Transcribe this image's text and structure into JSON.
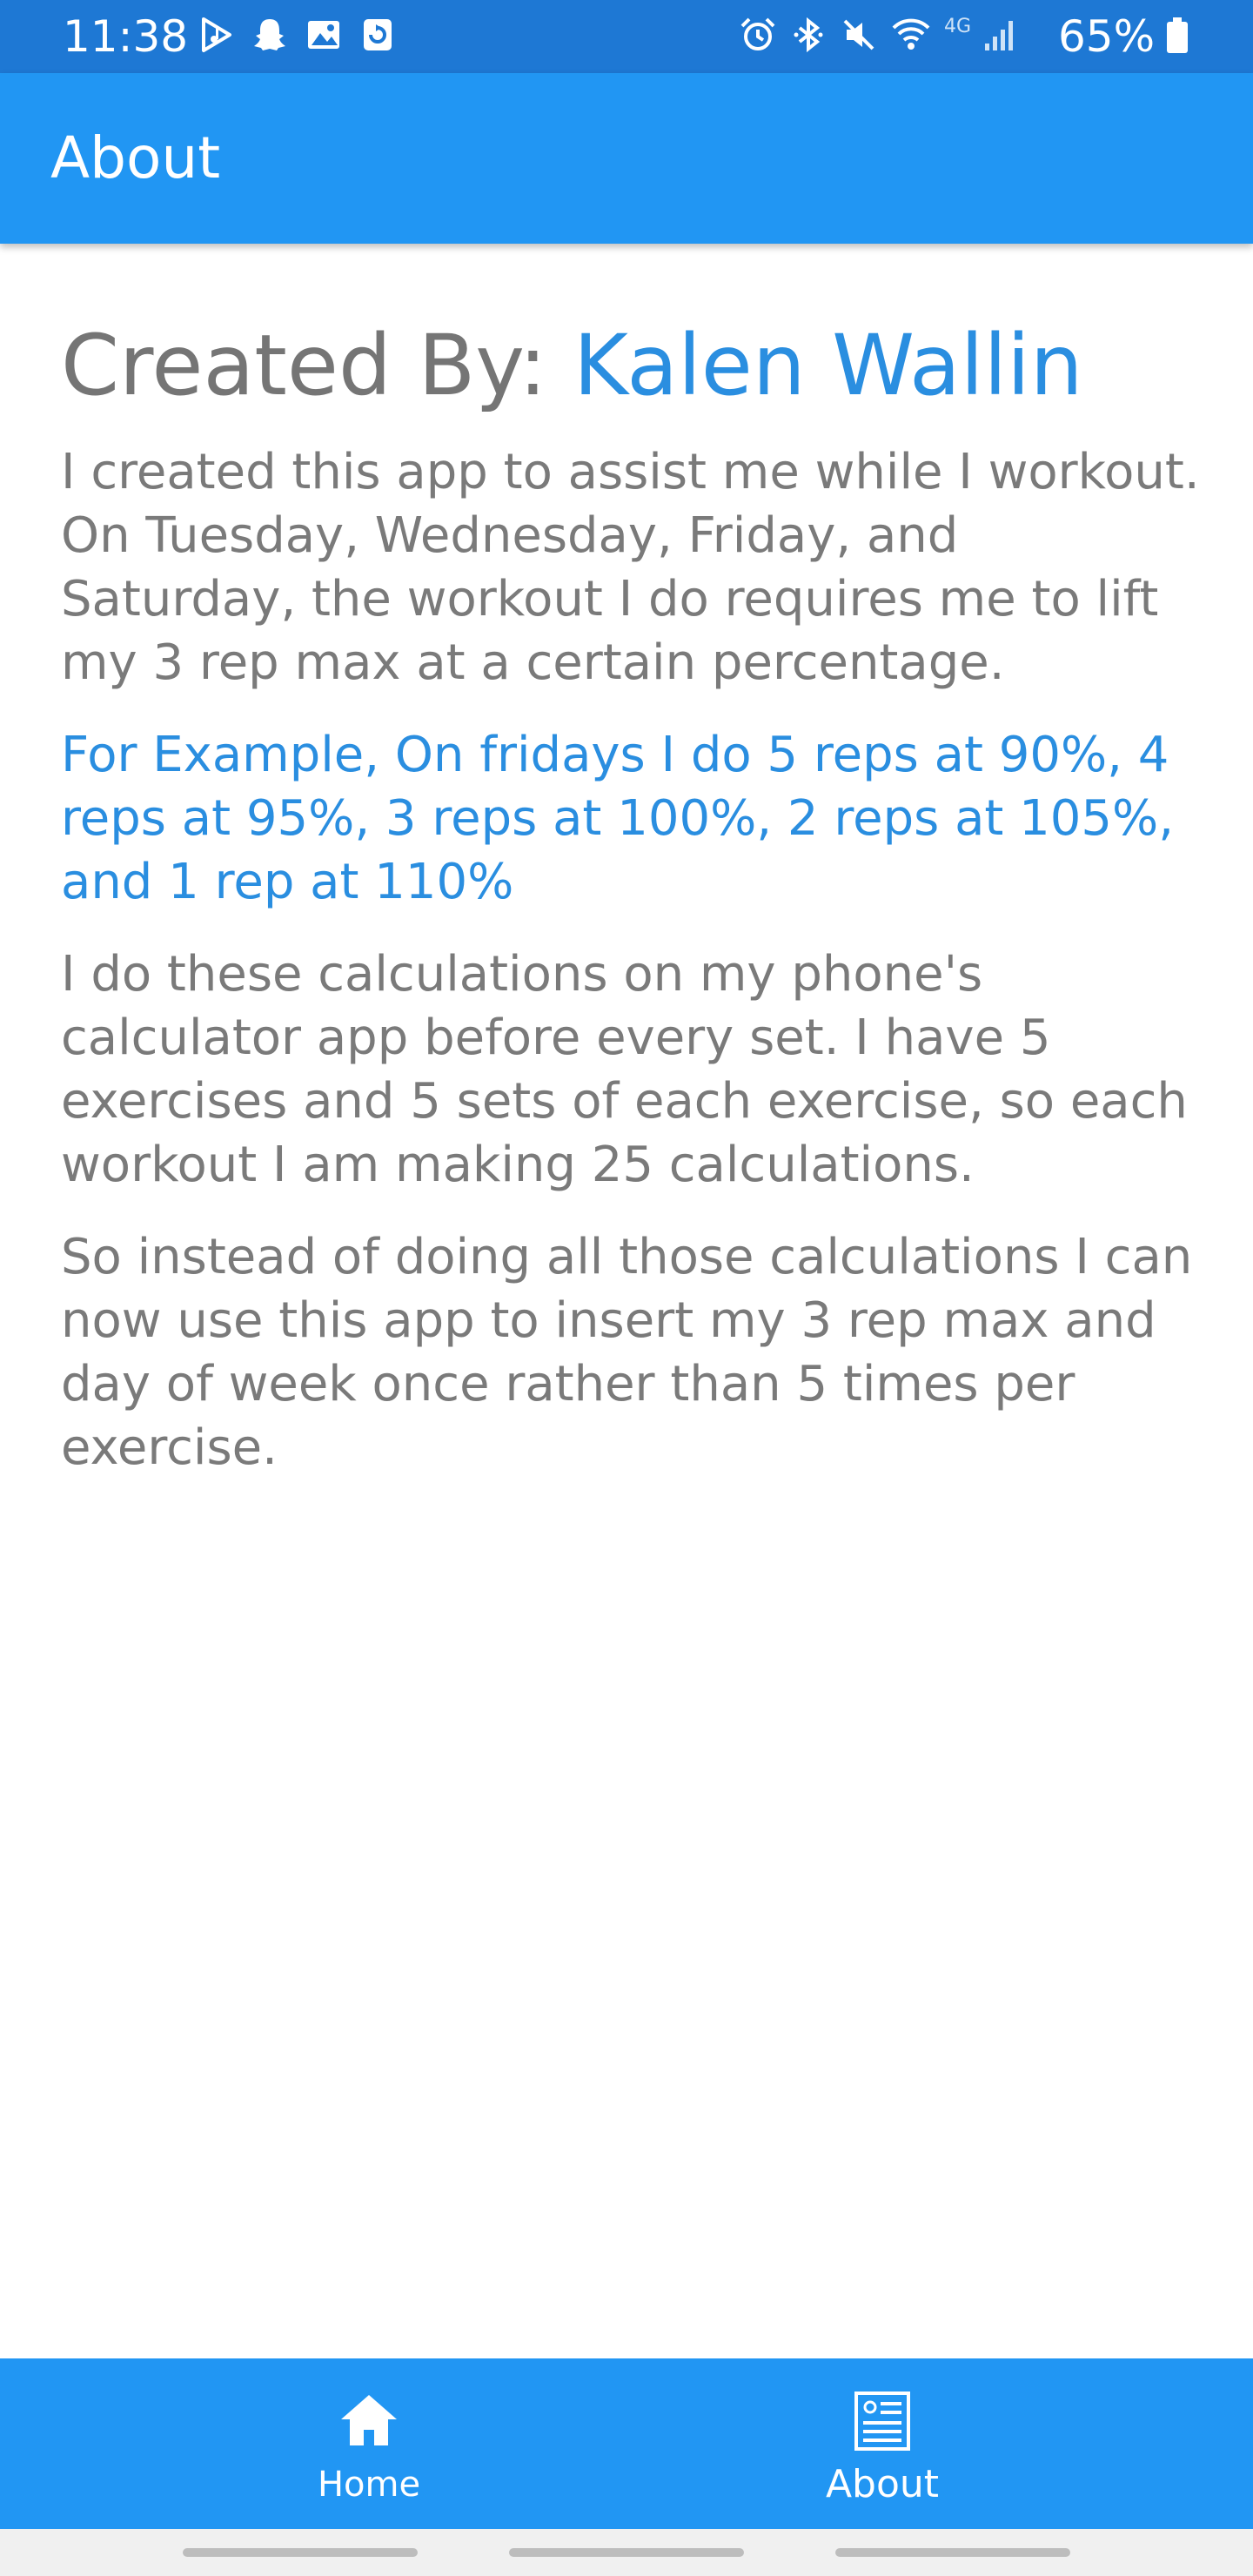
{
  "status_bar": {
    "time": "11:38",
    "battery": "65%",
    "network": "4G",
    "icons_left": [
      "play-store-icon",
      "snapchat-icon",
      "gallery-icon",
      "app-icon"
    ],
    "icons_right": [
      "alarm-icon",
      "bluetooth-icon",
      "mute-icon",
      "wifi-icon",
      "signal-icon",
      "battery-icon"
    ]
  },
  "app_bar": {
    "title": "About"
  },
  "content": {
    "heading_prefix": "Created By:",
    "author": "Kalen Wallin",
    "paragraphs": [
      "I created this app to assist me while I workout. On Tuesday, Wednesday, Friday, and Saturday, the workout I do requires me to lift my 3 rep max at a certain percentage.",
      "For Example, On fridays I do 5 reps at 90%, 4 reps at 95%, 3 reps at 100%, 2 reps at 105%, and 1 rep at 110%",
      "I do these calculations on my phone's calculator app before every set. I have 5 exercises and 5 sets of each exercise, so each workout I am making 25 calculations.",
      "So instead of doing all those calculations I can now use this app to insert my 3 rep max and day of week once rather than 5 times per exercise."
    ]
  },
  "bottom_nav": {
    "items": [
      {
        "label": "Home",
        "icon": "home-icon"
      },
      {
        "label": "About",
        "icon": "document-icon"
      }
    ]
  },
  "colors": {
    "status_bar": "#1e78d4",
    "app_bar": "#2196f3",
    "accent_text": "#2a8ee0",
    "body_text": "#7a7a7a"
  }
}
